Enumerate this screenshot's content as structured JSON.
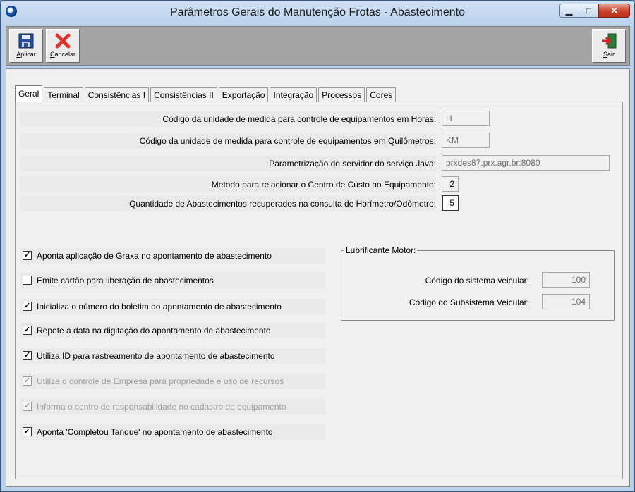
{
  "window": {
    "title": "Parâmetros Gerais do Manutenção Frotas - Abastecimento",
    "controls": {
      "minimize": "▁",
      "maximize": "□",
      "close": "✕"
    }
  },
  "toolbar": {
    "apply_label": "Aplicar",
    "cancel_label": "Cancelar",
    "exit_label": "Sair"
  },
  "tabs": [
    "Geral",
    "Terminal",
    "Consistências I",
    "Consistências II",
    "Exportação",
    "Integração",
    "Processos",
    "Cores"
  ],
  "active_tab": "Geral",
  "params": {
    "hours_unit": {
      "label": "Código da unidade de medida para controle de equipamentos em Horas:",
      "value": "H"
    },
    "km_unit": {
      "label": "Código da unidade de medida para controle de equipamentos em Quilômetros:",
      "value": "KM"
    },
    "java_server": {
      "label": "Parametrização do servidor do serviço Java:",
      "value": "prxdes87.prx.agr.br:8080"
    },
    "cost_center_method": {
      "label": "Metodo para relacionar o Centro de Custo no Equipamento:",
      "value": "2"
    },
    "refuel_count": {
      "label": "Quantidade de Abastecimentos recuperados na consulta de Horímetro/Odômetro:",
      "value": "5"
    }
  },
  "checkboxes": [
    {
      "label": "Aponta aplicação de Graxa no apontamento de abastecimento",
      "checked": true,
      "enabled": true,
      "mark": "✓"
    },
    {
      "label": "Emite cartão para liberação de abastecimentos",
      "checked": false,
      "enabled": true,
      "mark": ""
    },
    {
      "label": "Inicializa o número do boletim do apontamento de abastecimento",
      "checked": true,
      "enabled": true,
      "mark": "✓"
    },
    {
      "label": "Repete a data na digitação do apontamento de abastecimento",
      "checked": true,
      "enabled": true,
      "mark": "✓"
    },
    {
      "label": "Utiliza ID para rastreamento de apontamento de abastecimento",
      "checked": true,
      "enabled": true,
      "mark": "✓"
    },
    {
      "label": "Utiliza o controle de Empresa para propriedade e uso de recursos",
      "checked": true,
      "enabled": false,
      "mark": "✓"
    },
    {
      "label": "Informa o centro de responsabilidade no cadastro de equipamento",
      "checked": true,
      "enabled": false,
      "mark": "✓"
    },
    {
      "label": "Aponta 'Completou Tanque' no apontamento de abastecimento",
      "checked": true,
      "enabled": true,
      "mark": "✓"
    }
  ],
  "lubricant": {
    "title": "Lubrificante Motor:",
    "vehicle_system": {
      "label": "Código do sistema veicular:",
      "value": "100"
    },
    "vehicle_subsystem": {
      "label": "Código do Subsistema Veicular:",
      "value": "104"
    }
  },
  "colors": {
    "close_button": "#c8402a",
    "toolbar_bg": "#a4a4a4",
    "panel_bg": "#f0f0f0"
  }
}
